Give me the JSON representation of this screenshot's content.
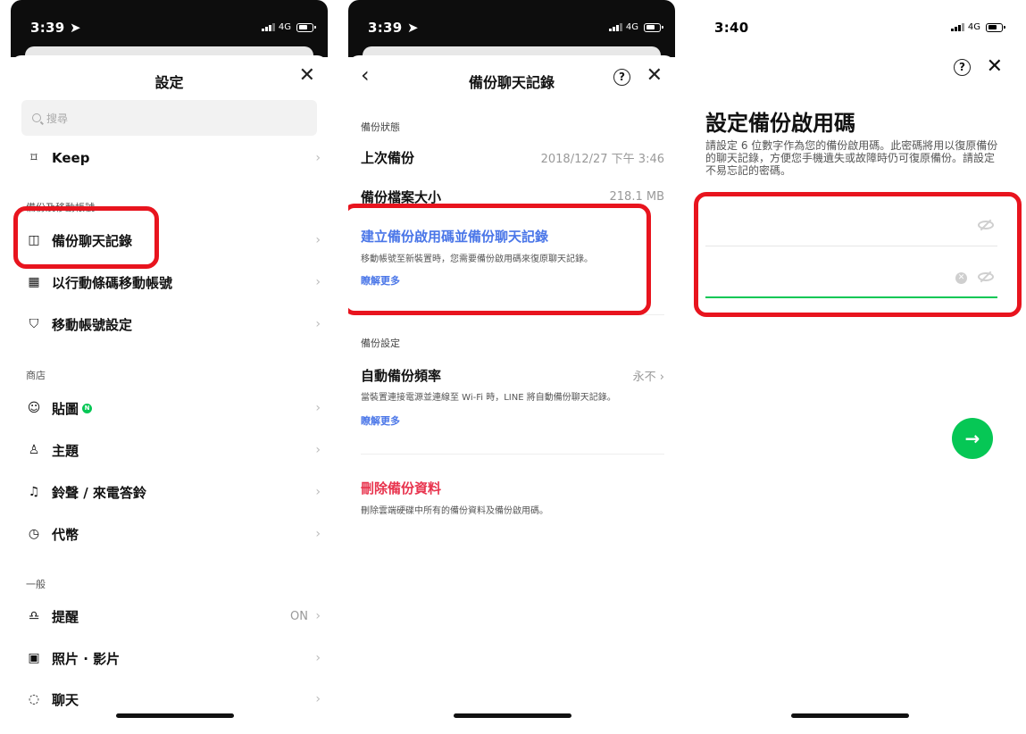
{
  "panel1": {
    "status": {
      "time": "3:39 ➤",
      "network": "4G"
    },
    "title": "設定",
    "search_placeholder": "搜尋",
    "keep_label": "Keep",
    "section_backup": "備份及移動帳號",
    "items_backup": [
      {
        "label": "備份聊天記錄",
        "icon": "chat-backup-icon"
      },
      {
        "label": "以行動條碼移動帳號",
        "icon": "qr-code-icon"
      },
      {
        "label": "移動帳號設定",
        "icon": "shield-icon"
      }
    ],
    "section_store": "商店",
    "items_store": [
      {
        "label": "貼圖",
        "icon": "sticker-icon",
        "badge": "N"
      },
      {
        "label": "主題",
        "icon": "theme-icon"
      },
      {
        "label": "鈴聲 / 來電答鈴",
        "icon": "music-note-icon"
      },
      {
        "label": "代幣",
        "icon": "coin-icon"
      }
    ],
    "section_general": "一般",
    "items_general": [
      {
        "label": "提醒",
        "icon": "bell-icon",
        "value": "ON"
      },
      {
        "label": "照片 · 影片",
        "icon": "photo-icon"
      },
      {
        "label": "聊天",
        "icon": "chat-icon"
      }
    ]
  },
  "panel2": {
    "status": {
      "time": "3:39 ➤",
      "network": "4G"
    },
    "title": "備份聊天記錄",
    "section_status": "備份狀態",
    "last_backup_label": "上次備份",
    "last_backup_value": "2018/12/27 下午 3:46",
    "size_label": "備份檔案大小",
    "size_value": "218.1 MB",
    "create_title": "建立備份啟用碼並備份聊天記錄",
    "create_desc": "移動帳號至新裝置時，您需要備份啟用碼來復原聊天記錄。",
    "learn_more": "瞭解更多",
    "section_settings": "備份設定",
    "auto_label": "自動備份頻率",
    "auto_value": "永不",
    "auto_desc": "當裝置連接電源並連線至 Wi-Fi 時，LINE 將自動備份聊天記錄。",
    "learn_more2": "瞭解更多",
    "delete_title": "刪除備份資料",
    "delete_desc": "刪除雲端硬碟中所有的備份資料及備份啟用碼。"
  },
  "panel3": {
    "status": {
      "time": "3:40",
      "network": "4G"
    },
    "title": "設定備份啟用碼",
    "desc": "請設定 6 位數字作為您的備份啟用碼。此密碼將用以復原備份的聊天記錄，方便您手機遺失或故障時仍可復原備份。請設定不易忘記的密碼。",
    "next_icon": "arrow-right-icon"
  },
  "colors": {
    "accent": "#06c755",
    "link": "#4a76e8",
    "danger": "#e8344e",
    "highlight": "#e8141e"
  }
}
